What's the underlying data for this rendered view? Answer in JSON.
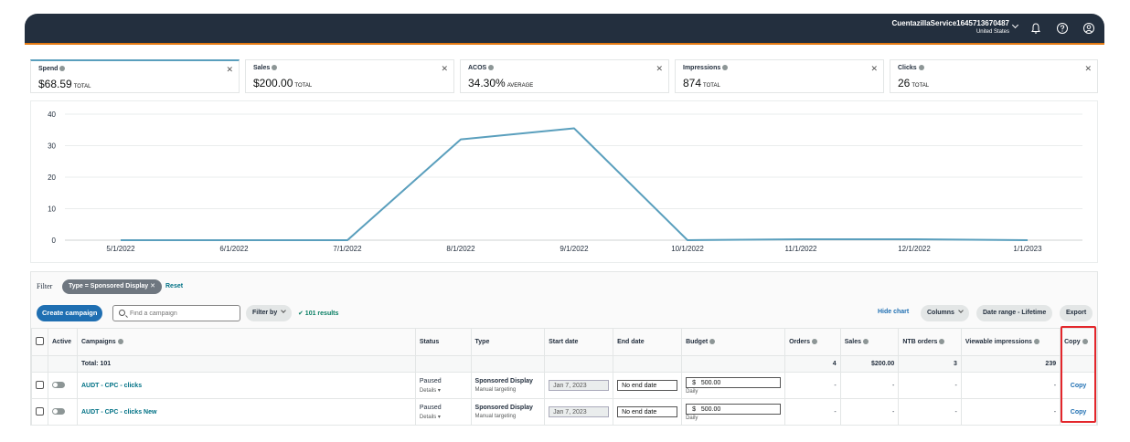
{
  "header": {
    "account_name": "CuentazillaService1645713670487",
    "country": "United States",
    "icons": [
      "bell-icon",
      "help-icon",
      "user-icon"
    ]
  },
  "metrics": [
    {
      "label": "Spend",
      "value": "$68.59",
      "unit": "TOTAL",
      "selected": true
    },
    {
      "label": "Sales",
      "value": "$200.00",
      "unit": "TOTAL"
    },
    {
      "label": "ACOS",
      "value": "34.30%",
      "unit": "AVERAGE"
    },
    {
      "label": "Impressions",
      "value": "874",
      "unit": "TOTAL"
    },
    {
      "label": "Clicks",
      "value": "26",
      "unit": "TOTAL"
    }
  ],
  "chart_data": {
    "type": "line",
    "x": [
      "5/1/2022",
      "6/1/2022",
      "7/1/2022",
      "8/1/2022",
      "9/1/2022",
      "10/1/2022",
      "11/1/2022",
      "12/1/2022",
      "1/1/2023"
    ],
    "series": [
      {
        "values": [
          0,
          0,
          0,
          32,
          35.5,
          0,
          0.3,
          0.3,
          0
        ]
      }
    ],
    "ylim": [
      0,
      40
    ],
    "yticks": [
      "0",
      "10",
      "20",
      "30",
      "40"
    ],
    "color": "#5a9fbd",
    "grid": true
  },
  "toolbar": {
    "filter_label": "Filter",
    "filter_chip": "Type = Sponsored Display ✕",
    "reset": "Reset",
    "create": "Create campaign",
    "search_placeholder": "Find a campaign",
    "filter_by": "Filter by",
    "results": "✔ 101 results",
    "hide_chart": "Hide chart",
    "columns": "Columns",
    "date_range": "Date range - Lifetime",
    "export": "Export"
  },
  "table": {
    "headers": {
      "active": "Active",
      "campaigns": "Campaigns",
      "status": "Status",
      "type": "Type",
      "start": "Start date",
      "end": "End date",
      "budget": "Budget",
      "orders": "Orders",
      "sales": "Sales",
      "ntb": "NTB orders",
      "viewable": "Viewable impressions",
      "copy": "Copy"
    },
    "total": {
      "label": "Total: 101",
      "orders": "4",
      "sales": "$200.00",
      "ntb": "3",
      "viewable": "239"
    },
    "rows": [
      {
        "name": "AUDT - CPC - clicks",
        "status": "Paused",
        "details": "Details ▾",
        "type": "Sponsored Display",
        "targeting": "Manual targeting",
        "start": "Jan 7, 2023",
        "end": "No end date",
        "currency": "$",
        "budget": "500.00",
        "budget_type": "Daily",
        "orders": "-",
        "sales": "-",
        "ntb": "-",
        "viewable": "-",
        "copy": "Copy"
      },
      {
        "name": "AUDT - CPC - clicks New",
        "status": "Paused",
        "details": "Details ▾",
        "type": "Sponsored Display",
        "targeting": "Manual targeting",
        "start": "Jan 7, 2023",
        "end": "No end date",
        "currency": "$",
        "budget": "500.00",
        "budget_type": "Daily",
        "orders": "-",
        "sales": "-",
        "ntb": "-",
        "viewable": "-",
        "copy": "Copy"
      }
    ]
  }
}
